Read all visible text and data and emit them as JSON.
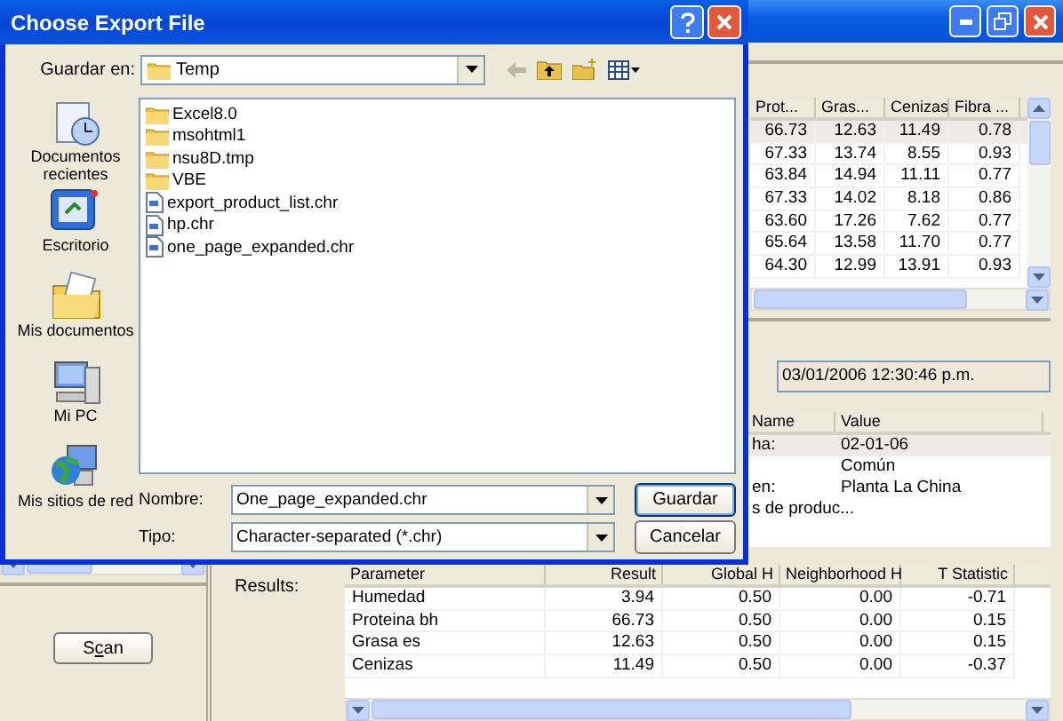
{
  "grid": {
    "columns": [
      "Prot...",
      "Gras...",
      "Cenizas",
      "Fibra ..."
    ],
    "rows": [
      {
        "cells": [
          "66.73",
          "12.63",
          "11.49",
          "0.78"
        ],
        "selected": true
      },
      {
        "cells": [
          "67.33",
          "13.74",
          "8.55",
          "0.93"
        ],
        "selected": false
      },
      {
        "cells": [
          "63.84",
          "14.94",
          "11.11",
          "0.77"
        ],
        "selected": false
      },
      {
        "cells": [
          "67.33",
          "14.02",
          "8.18",
          "0.86"
        ],
        "selected": false
      },
      {
        "cells": [
          "63.60",
          "17.26",
          "7.62",
          "0.77"
        ],
        "selected": false
      },
      {
        "cells": [
          "65.64",
          "13.58",
          "11.70",
          "0.77"
        ],
        "selected": false
      },
      {
        "cells": [
          "64.30",
          "12.99",
          "13.91",
          "0.93"
        ],
        "selected": false
      }
    ]
  },
  "date_field": {
    "value": "03/01/2006 12:30:46 p.m."
  },
  "properties": {
    "columns": [
      "Name",
      "Value"
    ],
    "rows": [
      {
        "name": "ha:",
        "value": "02-01-06",
        "selected": true
      },
      {
        "value": "Común",
        "selected": false
      },
      {
        "name": "en:",
        "value": "Planta La China",
        "selected": false
      },
      {
        "name": "s de produc...",
        "selected": false
      }
    ]
  },
  "results": {
    "label": "Results:",
    "columns": [
      "Parameter",
      "Result",
      "Global H",
      "Neighborhood H",
      "T Statistic"
    ],
    "rows": [
      [
        "Humedad",
        "3.94",
        "0.50",
        "0.00",
        "-0.71"
      ],
      [
        "Proteina bh",
        "66.73",
        "0.50",
        "0.00",
        "0.15"
      ],
      [
        "Grasa es",
        "12.63",
        "0.50",
        "0.00",
        "0.15"
      ],
      [
        "Cenizas",
        "11.49",
        "0.50",
        "0.00",
        "-0.37"
      ]
    ]
  },
  "scan_button": {
    "label": "Scan"
  },
  "dialog": {
    "title": "Choose Export File",
    "save_in_label": "Guardar en:",
    "folder": "Temp",
    "places": [
      {
        "label": "Documentos recientes",
        "kind": "recent"
      },
      {
        "label": "Escritorio",
        "kind": "desktop"
      },
      {
        "label": "Mis documentos",
        "kind": "documents"
      },
      {
        "label": "Mi PC",
        "kind": "computer"
      },
      {
        "label": "Mis sitios de red",
        "kind": "network"
      }
    ],
    "files": [
      {
        "name": "Excel8.0",
        "kind": "folder"
      },
      {
        "name": "msohtml1",
        "kind": "folder"
      },
      {
        "name": "nsu8D.tmp",
        "kind": "folder"
      },
      {
        "name": "VBE",
        "kind": "folder"
      },
      {
        "name": "export_product_list.chr",
        "kind": "file"
      },
      {
        "name": "hp.chr",
        "kind": "file"
      },
      {
        "name": "one_page_expanded.chr",
        "kind": "file"
      }
    ],
    "name_label": "Nombre:",
    "name_value": "One_page_expanded.chr",
    "type_label": "Tipo:",
    "type_value": "Character-separated (*.chr)",
    "buttons": [
      {
        "label": "Guardar",
        "default": true
      },
      {
        "label": "Cancelar",
        "default": false
      }
    ]
  }
}
